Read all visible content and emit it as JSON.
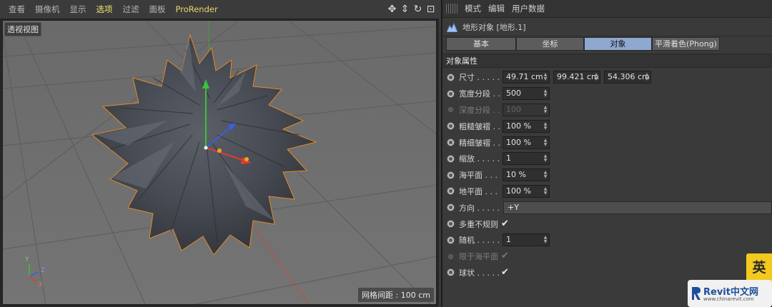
{
  "viewport": {
    "menu": [
      "查看",
      "摄像机",
      "显示",
      "选项",
      "过滤",
      "面板",
      "ProRender"
    ],
    "active_menu": "选项",
    "tools": [
      "move-view-icon",
      "zoom-view-icon",
      "rotate-view-icon",
      "maximize-view-icon"
    ],
    "view_label": "透视视图",
    "grid_spacing": "网格间距 : 100 cm",
    "axis_labels": {
      "y": "Y",
      "z": "Z",
      "x": "X"
    }
  },
  "attributes": {
    "menu": [
      "模式",
      "编辑",
      "用户数据"
    ],
    "object_title": "地形对象 [地形.1]",
    "tabs": [
      "基本",
      "坐标",
      "对象",
      "平滑着色(Phong)"
    ],
    "active_tab": "对象",
    "section_title": "对象属性",
    "properties": [
      {
        "label": "尺寸 . . . . .",
        "kind": "vector",
        "values": [
          "49.71 cm",
          "99.421 cm",
          "54.306 cm"
        ]
      },
      {
        "label": "宽度分段 . .",
        "kind": "number",
        "value": "500"
      },
      {
        "label": "深度分段 . .",
        "kind": "number",
        "value": "100",
        "disabled": true
      },
      {
        "label": "粗糙皱褶 . .",
        "kind": "number",
        "value": "100 %"
      },
      {
        "label": "精细皱褶 . .",
        "kind": "number",
        "value": "100 %"
      },
      {
        "label": "缩放 . . . . .",
        "kind": "number",
        "value": "1"
      },
      {
        "label": "海平面 . . .",
        "kind": "number",
        "value": "10 %"
      },
      {
        "label": "地平面 . . .",
        "kind": "number",
        "value": "100 %"
      },
      {
        "label": "方向 . . . . .",
        "kind": "dropdown",
        "value": "+Y"
      },
      {
        "label": "多重不规则",
        "kind": "checkbox",
        "value": "✔"
      },
      {
        "label": "随机 . . . . .",
        "kind": "number",
        "value": "1"
      },
      {
        "label": "限于海平面",
        "kind": "checkbox",
        "value": "✔",
        "disabled": true
      },
      {
        "label": "球状 . . . . .",
        "kind": "checkbox",
        "value": "✔"
      }
    ]
  },
  "watermark": {
    "badge": "英",
    "logo_text": "Revit中文网",
    "logo_sub": "www.chinarevit.com"
  },
  "colors": {
    "accent_tab": "#8fa8d0",
    "active_menu": "#f2e36c",
    "axis_x": "#e23b2b",
    "axis_y": "#3bc13b",
    "axis_z": "#3a5ee0",
    "selection_outline": "#e08a2a"
  }
}
